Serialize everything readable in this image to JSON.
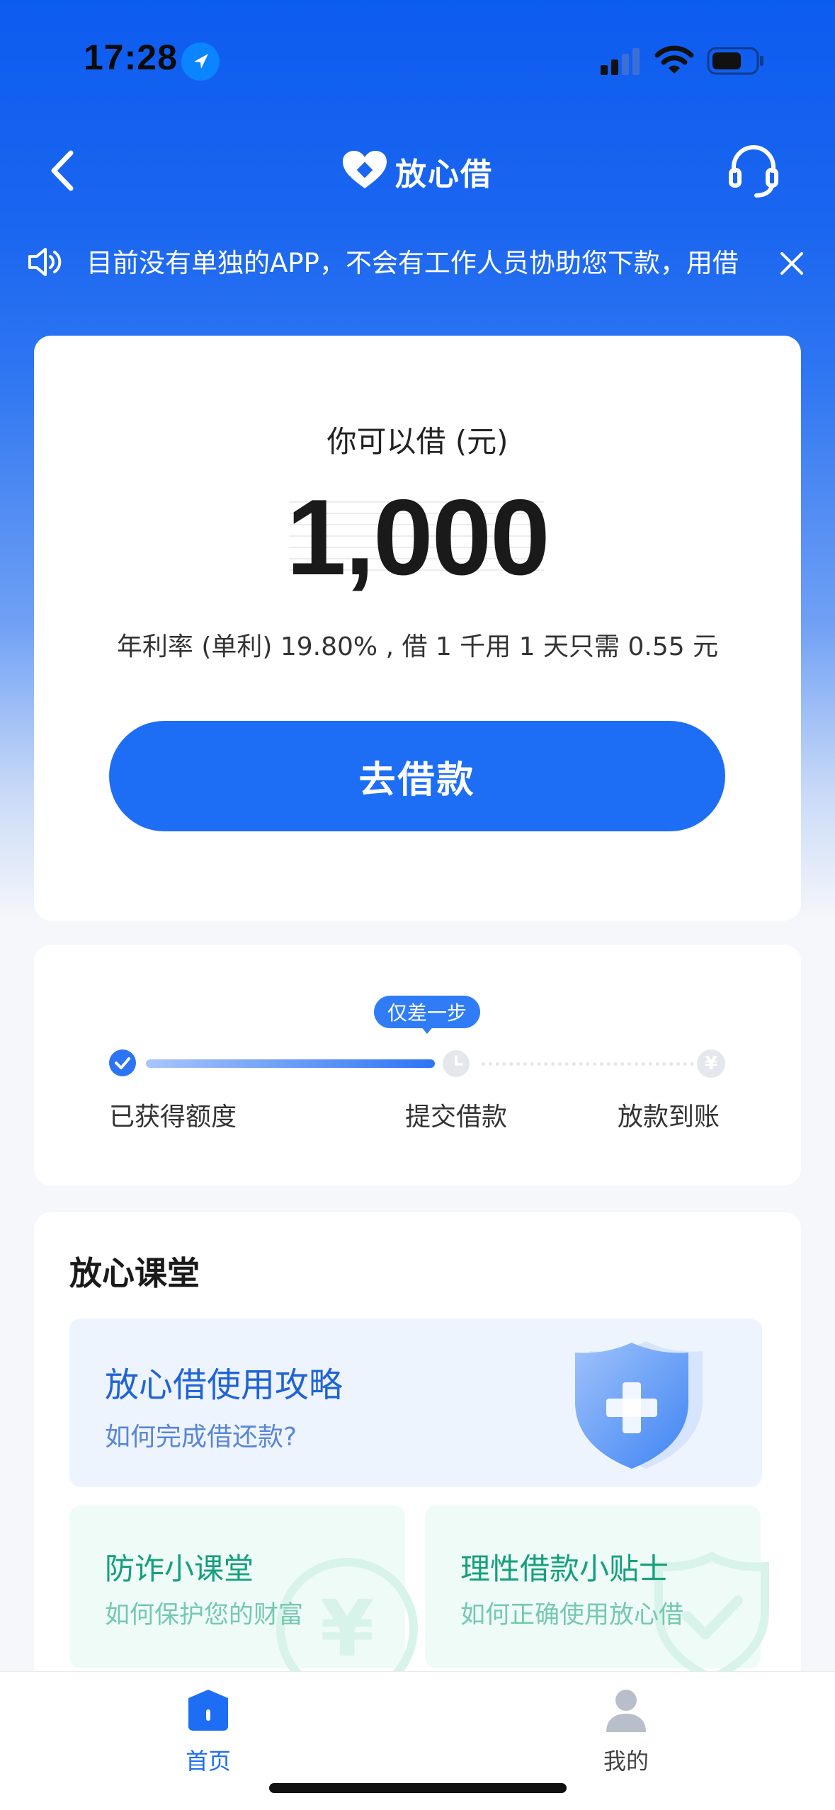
{
  "status_bar": {
    "time": "17:28"
  },
  "nav": {
    "title": "放心借"
  },
  "notice": {
    "text": "目前没有单独的APP，不会有工作人员协助您下款，用借"
  },
  "loan_card": {
    "label": "你可以借 (元)",
    "amount": "1,000",
    "rate_text": "年利率 (单利) 19.80% , 借 1 千用 1 天只需 0.55 元",
    "cta": "去借款"
  },
  "steps": {
    "badge": "仅差一步",
    "items": [
      "已获得额度",
      "提交借款",
      "放款到账"
    ]
  },
  "classroom": {
    "title": "放心课堂",
    "guide": {
      "title": "放心借使用攻略",
      "subtitle": "如何完成借还款?"
    },
    "cards": [
      {
        "title": "防诈小课堂",
        "subtitle": "如何保护您的财富"
      },
      {
        "title": "理性借款小贴士",
        "subtitle": "如何正确使用放心借"
      }
    ]
  },
  "tabbar": {
    "items": [
      "首页",
      "我的"
    ]
  },
  "colors": {
    "primary": "#1d6ef5",
    "header_blue": "#0d5cf0",
    "green": "#14a07c"
  }
}
